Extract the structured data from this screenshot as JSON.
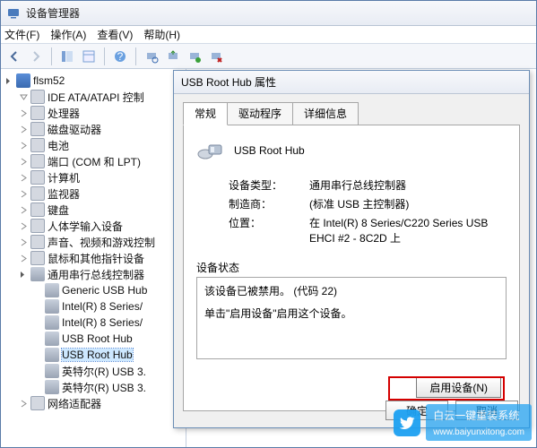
{
  "window": {
    "title": "设备管理器"
  },
  "menu": {
    "file": "文件(F)",
    "action": "操作(A)",
    "view": "查看(V)",
    "help": "帮助(H)"
  },
  "tree": {
    "root": "flsm52",
    "items": [
      "IDE ATA/ATAPI 控制",
      "处理器",
      "磁盘驱动器",
      "电池",
      "端口 (COM 和 LPT)",
      "计算机",
      "监视器",
      "键盘",
      "人体学输入设备",
      "声音、视频和游戏控制",
      "鼠标和其他指针设备",
      "通用串行总线控制器"
    ],
    "usb_children": [
      "Generic USB Hub",
      "Intel(R) 8 Series/",
      "Intel(R) 8 Series/",
      "USB Root Hub",
      "USB Root Hub",
      "英特尔(R) USB 3.",
      "英特尔(R) USB 3."
    ],
    "last": "网络适配器"
  },
  "dialog": {
    "title": "USB Root Hub 属性",
    "tabs": {
      "general": "常规",
      "driver": "驱动程序",
      "details": "详细信息"
    },
    "device_name": "USB Root Hub",
    "labels": {
      "type": "设备类型：",
      "mfr": "制造商：",
      "loc": "位置："
    },
    "values": {
      "type": "通用串行总线控制器",
      "mfr": "(标准 USB 主控制器)",
      "loc": "在 Intel(R) 8 Series/C220 Series USB EHCI #2 - 8C2D 上"
    },
    "status_label": "设备状态",
    "status_line1": "该设备已被禁用。 (代码 22)",
    "status_line2": "单击\"启用设备\"启用这个设备。",
    "enable_btn": "启用设备(N)",
    "ok": "确定",
    "cancel": "取消"
  },
  "watermark": {
    "text": "白云一键重装系统",
    "url": "www.baiyunxitong.com"
  }
}
